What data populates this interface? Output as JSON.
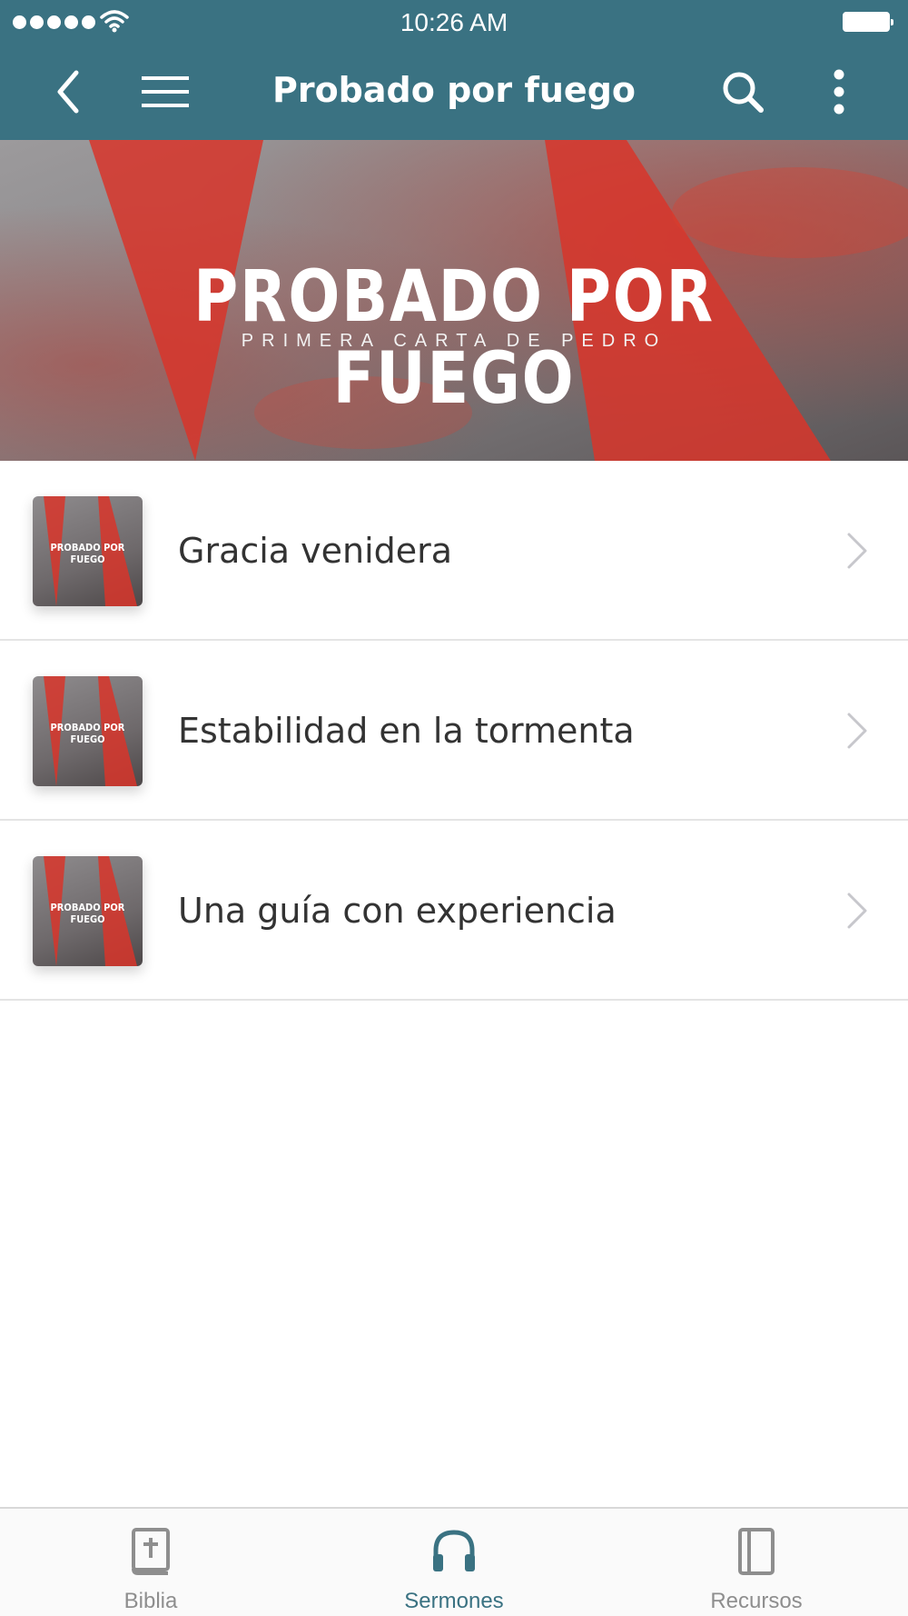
{
  "status_bar": {
    "time": "10:26 AM"
  },
  "nav": {
    "title": "Probado por fuego"
  },
  "banner": {
    "title": "PROBADO POR FUEGO",
    "subtitle": "PRIMERA CARTA DE PEDRO"
  },
  "sermons": [
    {
      "title": "Gracia venidera",
      "thumb_label": "PROBADO POR FUEGO"
    },
    {
      "title": "Estabilidad en la tormenta",
      "thumb_label": "PROBADO POR FUEGO"
    },
    {
      "title": "Una guía con experiencia",
      "thumb_label": "PROBADO POR FUEGO"
    }
  ],
  "tabs": [
    {
      "label": "Biblia",
      "icon": "bible-icon",
      "active": false
    },
    {
      "label": "Sermones",
      "icon": "headphones-icon",
      "active": true
    },
    {
      "label": "Recursos",
      "icon": "book-icon",
      "active": false
    }
  ],
  "colors": {
    "accent": "#3a7282",
    "banner_red": "#d8352a",
    "text": "#333333",
    "inactive_tab": "#8e8e8e"
  }
}
